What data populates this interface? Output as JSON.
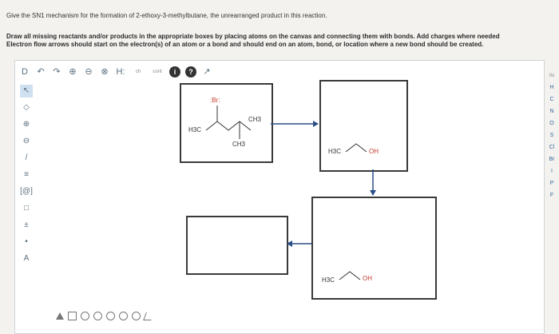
{
  "question": {
    "line1": "Give the SN1 mechanism for the formation of 2-ethoxy-3-methylbutane, the unrearranged product in this reaction.",
    "line2": "Draw all missing reactants and/or products in the appropriate boxes by placing atoms on the canvas and connecting them with bonds. Add charges where needed",
    "line3": "Electron flow arrows should start on the electron(s) of an atom or a bond and should end on an atom, bond, or location where a new bond should be created."
  },
  "toolbar_top": [
    "D",
    "↶",
    "↷",
    "⊕",
    "⊖",
    "⊗",
    "H:",
    "ch",
    "cont",
    "i",
    "?",
    "↗"
  ],
  "toolbar_left": [
    "↖",
    "◇",
    "⊕",
    "⊖",
    "/",
    "≡",
    "[@]",
    "□",
    "±",
    "•",
    "A"
  ],
  "toolbar_bottom_shapes": [
    "triangle",
    "square",
    "pentagon",
    "hexagon",
    "heptagon",
    "octagon",
    "circle",
    "bond"
  ],
  "elements": [
    "Ilo",
    "H",
    "C",
    "N",
    "O",
    "S",
    "Cl",
    "Br",
    "I",
    "P",
    "F"
  ],
  "molecules": {
    "box1": {
      "br": ":Br:",
      "ch3_left": "H3C",
      "ch3_right": "CH3",
      "ch3_bottom": "CH3"
    },
    "box2": {
      "h3c": "H3C",
      "oh": "OH"
    },
    "box3": {
      "h3c": "H3C",
      "oh": "OH"
    }
  }
}
